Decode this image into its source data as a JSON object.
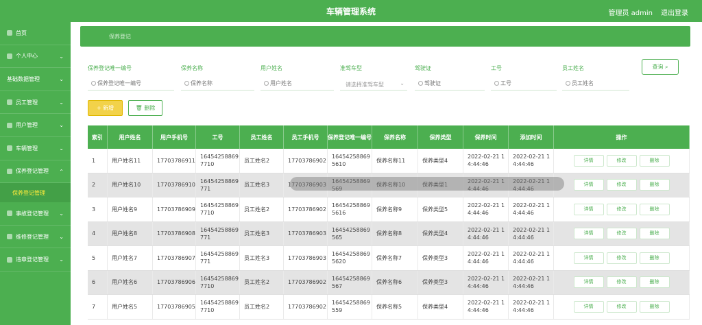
{
  "header": {
    "title": "车辆管理系统",
    "admin": "管理员 admin",
    "logout": "退出登录"
  },
  "sidebar": {
    "items": [
      {
        "label": "首页"
      },
      {
        "label": "个人中心"
      },
      {
        "label": "基础数据管理"
      },
      {
        "label": "员工管理"
      },
      {
        "label": "用户管理"
      },
      {
        "label": "车辆管理"
      },
      {
        "label": "保养登记管理"
      }
    ],
    "active_sub": "保养登记管理",
    "items_after": [
      {
        "label": "事故登记管理"
      },
      {
        "label": "维修登记管理"
      },
      {
        "label": "违章登记管理"
      }
    ]
  },
  "breadcrumb": "保养登记",
  "filters": {
    "labels": [
      "保养登记唯一编号",
      "保养名称",
      "用户姓名",
      "准驾车型",
      "驾驶证",
      "工号",
      "员工姓名"
    ],
    "placeholders": [
      "保养登记唯一编号",
      "保养名称",
      "用户姓名",
      "请选择准驾车型",
      "驾驶证",
      "工号",
      "员工姓名"
    ],
    "query": "查询"
  },
  "toolbar": {
    "add": "新增",
    "delete": "删除"
  },
  "table": {
    "headers": [
      "索引",
      "用户姓名",
      "用户手机号",
      "工号",
      "员工姓名",
      "员工手机号",
      "保养登记唯一编号",
      "保养名称",
      "保养类型",
      "保养时间",
      "添加时间",
      "操作"
    ],
    "rows": [
      [
        "1",
        "用户姓名11",
        "17703786911",
        "164542588697710",
        "员工姓名2",
        "17703786902",
        "164542588695610",
        "保养名称11",
        "保养类型4",
        "2022-02-21 14:44:46",
        "2022-02-21 14:44:46"
      ],
      [
        "2",
        "用户姓名10",
        "17703786910",
        "16454258869771",
        "员工姓名3",
        "17703786903",
        "16454258869569",
        "保养名称10",
        "保养类型1",
        "2022-02-21 14:44:46",
        "2022-02-21 14:44:46"
      ],
      [
        "3",
        "用户姓名9",
        "17703786909",
        "164542588697710",
        "员工姓名2",
        "17703786902",
        "164542588695616",
        "保养名称9",
        "保养类型5",
        "2022-02-21 14:44:46",
        "2022-02-21 14:44:46"
      ],
      [
        "4",
        "用户姓名8",
        "17703786908",
        "16454258869771",
        "员工姓名3",
        "17703786903",
        "16454258869565",
        "保养名称8",
        "保养类型4",
        "2022-02-21 14:44:46",
        "2022-02-21 14:44:46"
      ],
      [
        "5",
        "用户姓名7",
        "17703786907",
        "16454258869771",
        "员工姓名3",
        "17703786903",
        "164542588695620",
        "保养名称7",
        "保养类型3",
        "2022-02-21 14:44:46",
        "2022-02-21 14:44:46"
      ],
      [
        "6",
        "用户姓名6",
        "17703786906",
        "164542588697710",
        "员工姓名2",
        "17703786902",
        "16454258869567",
        "保养名称6",
        "保养类型3",
        "2022-02-21 14:44:46",
        "2022-02-21 14:44:46"
      ],
      [
        "7",
        "用户姓名5",
        "17703786905",
        "164542588697710",
        "员工姓名2",
        "17703786902",
        "16454258869559",
        "保养名称5",
        "保养类型4",
        "2022-02-21 14:44:46",
        "2022-02-21 14:44:46"
      ]
    ],
    "actions": [
      "详情",
      "修改",
      "删除"
    ]
  },
  "colors": {
    "primary": "#4caf50",
    "accent": "#f2d24a",
    "active_sub": "#ffeb3b"
  }
}
